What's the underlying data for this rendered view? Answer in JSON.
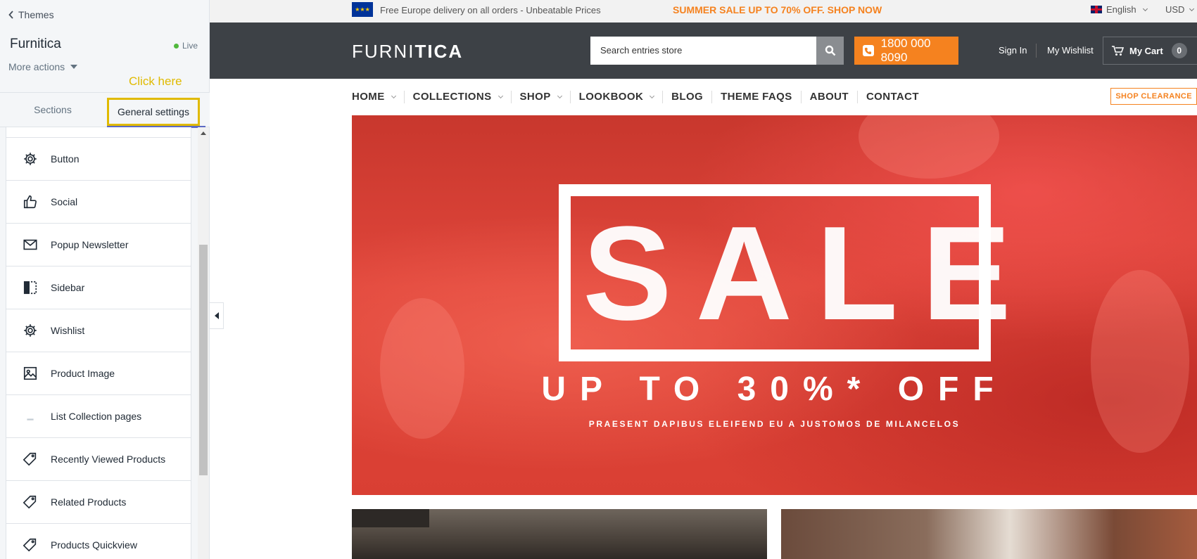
{
  "editor": {
    "back_label": "Themes",
    "theme_name": "Furnitica",
    "status": "Live",
    "more_actions": "More actions",
    "annotation": "Click here",
    "tabs": {
      "sections": "Sections",
      "general": "General settings"
    },
    "settings_list": [
      {
        "label": "Button",
        "icon": "gear-icon"
      },
      {
        "label": "Social",
        "icon": "thumbs-up-icon"
      },
      {
        "label": "Popup Newsletter",
        "icon": "envelope-icon"
      },
      {
        "label": "Sidebar",
        "icon": "sidebar-icon"
      },
      {
        "label": "Wishlist",
        "icon": "gear-icon"
      },
      {
        "label": "Product Image",
        "icon": "image-icon"
      },
      {
        "label": "List Collection pages",
        "icon": "dash-icon"
      },
      {
        "label": "Recently Viewed Products",
        "icon": "tag-icon"
      },
      {
        "label": "Related Products",
        "icon": "tag-icon"
      },
      {
        "label": "Products Quickview",
        "icon": "tag-icon"
      }
    ]
  },
  "store": {
    "topbar": {
      "delivery": "Free Europe delivery on all orders - Unbeatable Prices",
      "promo": "SUMMER SALE UP TO 70% OFF. SHOP NOW",
      "language": "English",
      "currency": "USD"
    },
    "header": {
      "logo_light": "FURNI",
      "logo_bold": "TICA",
      "search_placeholder": "Search entries store",
      "phone": "1800 000 8090",
      "sign_in": "Sign In",
      "wishlist": "My Wishlist",
      "cart_label": "My Cart",
      "cart_count": "0"
    },
    "nav": {
      "home": "HOME",
      "collections": "COLLECTIONS",
      "shop": "SHOP",
      "lookbook": "LOOKBOOK",
      "blog": "BLOG",
      "faqs": "THEME FAQS",
      "about": "ABOUT",
      "contact": "CONTACT",
      "clearance": "SHOP CLEARANCE"
    },
    "hero": {
      "headline": "SALE",
      "offer": "UP TO 30%* OFF",
      "subline": "PRAESENT DAPIBUS ELEIFEND EU A JUSTOMOS DE MILANCELOS"
    }
  },
  "colors": {
    "accent_orange": "#f5821f",
    "header_dark": "#3d4146",
    "annotation_yellow": "#e0ba00",
    "live_green": "#50b83c"
  }
}
